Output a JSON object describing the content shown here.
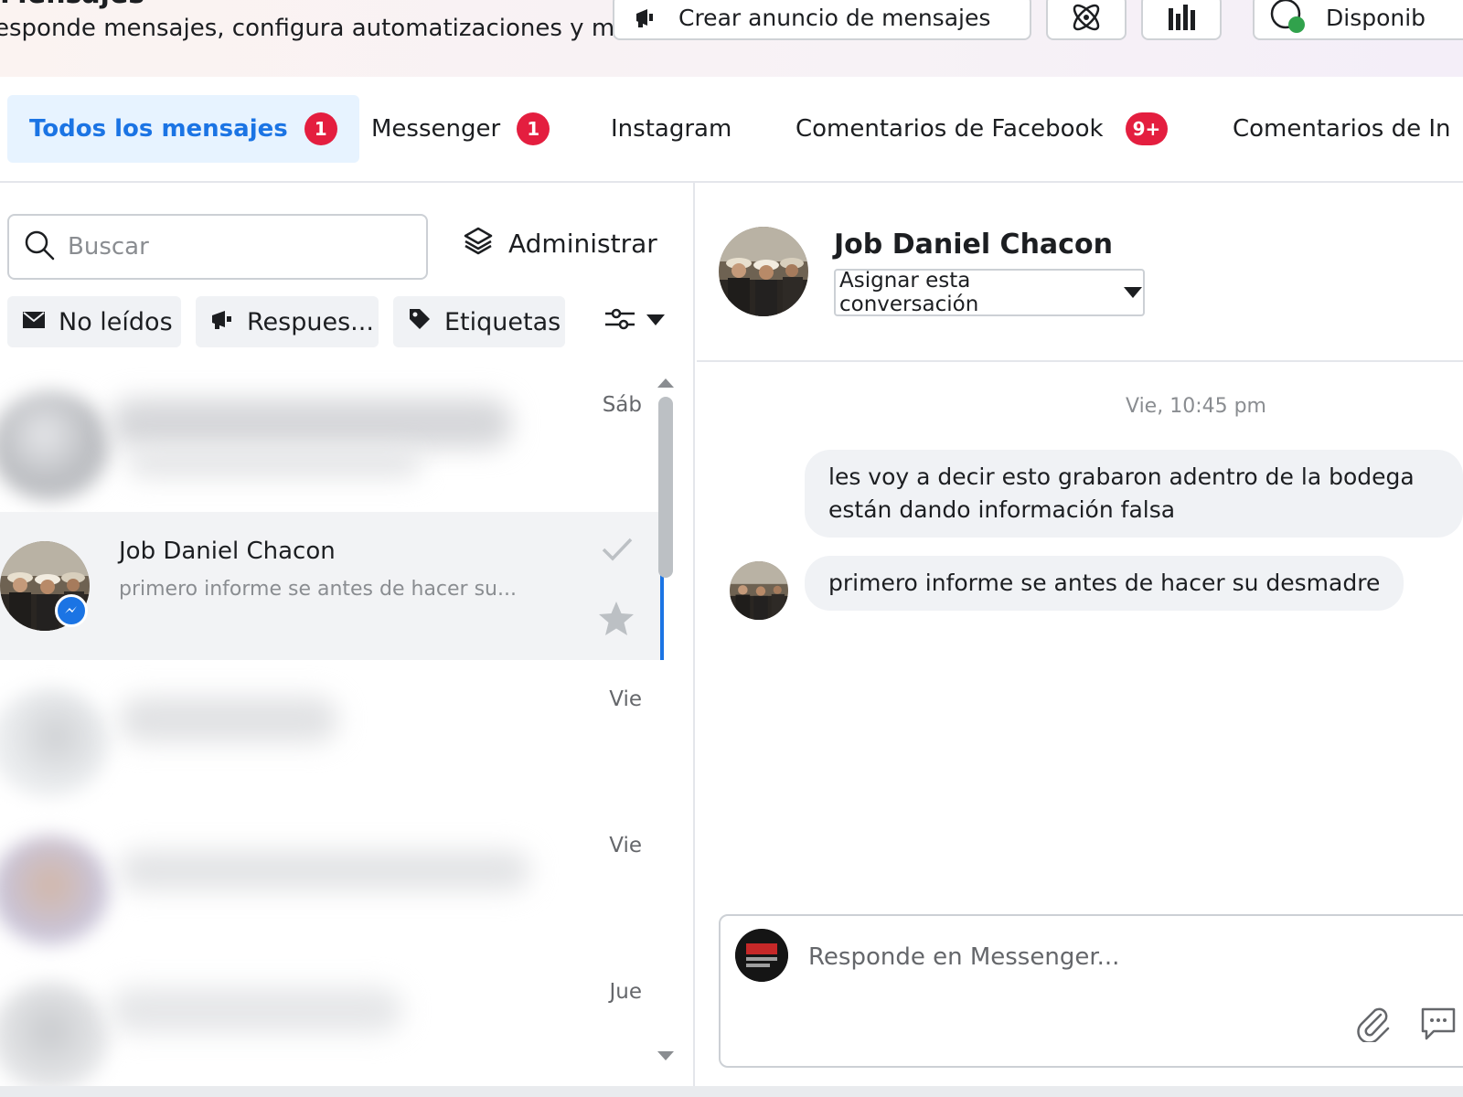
{
  "header": {
    "title": "Mensajes",
    "subtitle": "esponde mensajes, configura automatizaciones y m...",
    "create_ad_label": "Crear anuncio de mensajes",
    "availability_label": "Disponib"
  },
  "tabs": [
    {
      "label": "Todos los mensajes",
      "badge": "1",
      "active": true
    },
    {
      "label": "Messenger",
      "badge": "1"
    },
    {
      "label": "Instagram"
    },
    {
      "label": "Comentarios de Facebook",
      "badge": "9+"
    },
    {
      "label": "Comentarios de In"
    }
  ],
  "search": {
    "placeholder": "Buscar"
  },
  "manage_label": "Administrar",
  "filters": [
    {
      "label": "No leídos",
      "icon": "envelope-icon"
    },
    {
      "label": "Respues...",
      "icon": "megaphone-icon"
    },
    {
      "label": "Etiquetas",
      "icon": "tag-icon"
    }
  ],
  "conversations": [
    {
      "name": "",
      "preview": "",
      "date": "Sáb",
      "blurred": true
    },
    {
      "name": "Job Daniel Chacon",
      "preview": "primero informe se antes de hacer su...",
      "date": "",
      "selected": true,
      "platform": "messenger-icon"
    },
    {
      "name": "",
      "preview": "",
      "date": "Vie",
      "blurred": true
    },
    {
      "name": "",
      "preview": "",
      "date": "Vie",
      "blurred": true
    },
    {
      "name": "",
      "preview": "",
      "date": "Jue",
      "blurred": true
    }
  ],
  "chat": {
    "contact_name": "Job Daniel Chacon",
    "assign_label": "Asignar esta conversación",
    "timestamp": "Vie, 10:45 pm",
    "messages": [
      {
        "text": "les voy a decir esto grabaron adentro de la bodega están dando información falsa"
      },
      {
        "text": "primero informe se antes de hacer su desmadre"
      }
    ],
    "composer_placeholder": "Responde en Messenger..."
  },
  "colors": {
    "accent": "#1b74e4",
    "badge": "#e41e3f",
    "active_tab_bg": "#e7f3ff",
    "bubble_bg": "#f0f2f5",
    "status_green": "#31a24c"
  }
}
